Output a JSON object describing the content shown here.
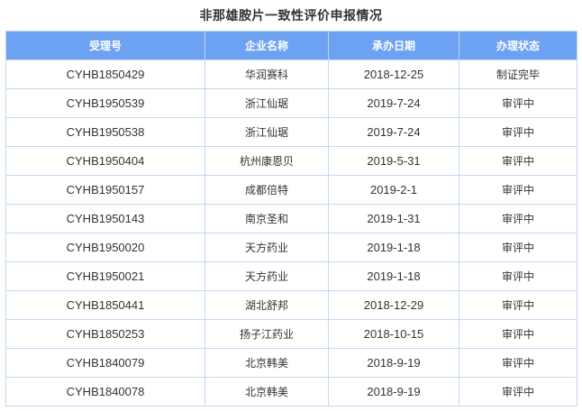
{
  "title": "非那雄胺片一致性评价申报情况",
  "table": {
    "headers": [
      "受理号",
      "企业名称",
      "承办日期",
      "办理状态"
    ],
    "rows": [
      [
        "CYHB1850429",
        "华润赛科",
        "2018-12-25",
        "制证完毕"
      ],
      [
        "CYHB1950539",
        "浙江仙琚",
        "2019-7-24",
        "审评中"
      ],
      [
        "CYHB1950538",
        "浙江仙琚",
        "2019-7-24",
        "审评中"
      ],
      [
        "CYHB1950404",
        "杭州康恩贝",
        "2019-5-31",
        "审评中"
      ],
      [
        "CYHB1950157",
        "成都倍特",
        "2019-2-1",
        "审评中"
      ],
      [
        "CYHB1950143",
        "南京圣和",
        "2019-1-31",
        "审评中"
      ],
      [
        "CYHB1950020",
        "天方药业",
        "2019-1-18",
        "审评中"
      ],
      [
        "CYHB1950021",
        "天方药业",
        "2019-1-18",
        "审评中"
      ],
      [
        "CYHB1850441",
        "湖北舒邦",
        "2018-12-29",
        "审评中"
      ],
      [
        "CYHB1850253",
        "扬子江药业",
        "2018-10-15",
        "审评中"
      ],
      [
        "CYHB1840079",
        "北京韩美",
        "2018-9-19",
        "审评中"
      ],
      [
        "CYHB1840078",
        "北京韩美",
        "2018-9-19",
        "审评中"
      ]
    ]
  },
  "colors": {
    "header_bg": "#6da1f2",
    "header_text": "#ffffff",
    "border": "#c3d7f6",
    "text": "#333333"
  }
}
